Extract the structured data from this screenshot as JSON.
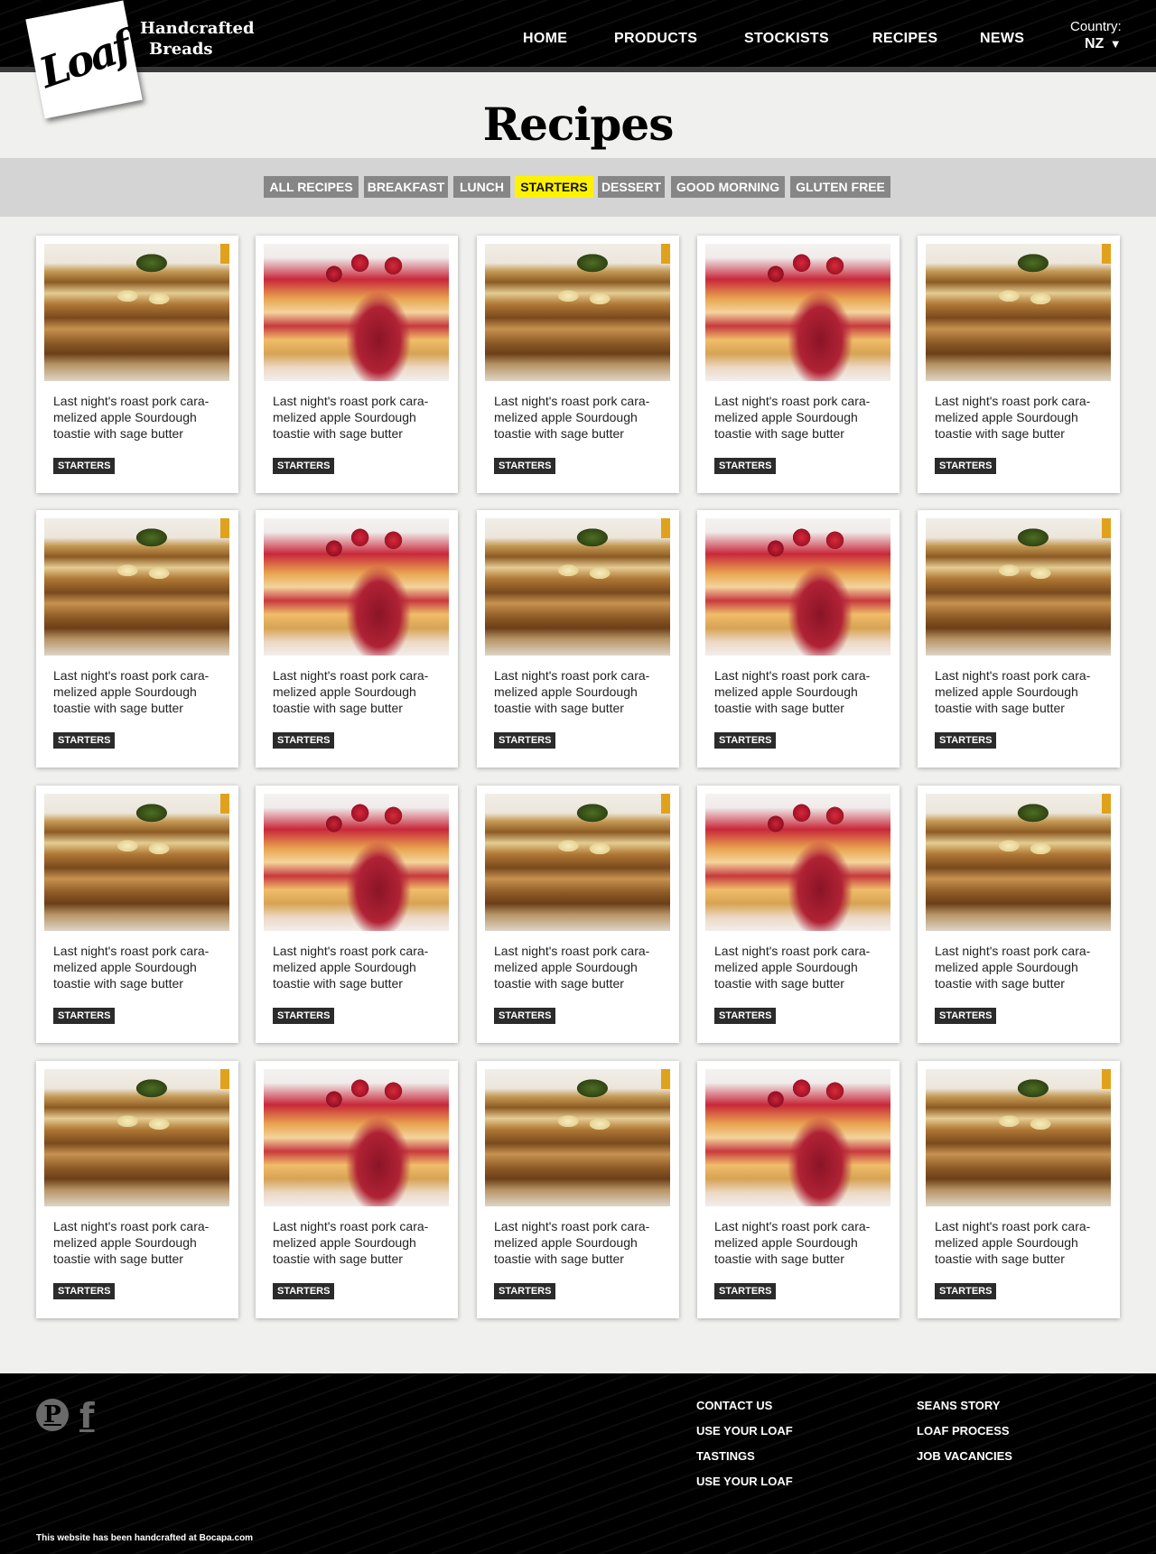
{
  "header": {
    "logo": "Loaf",
    "tagline_line1": "Handcrafted",
    "tagline_line2": "Breads",
    "nav": [
      "HOME",
      "PRODUCTS",
      "STOCKISTS",
      "RECIPES",
      "NEWS"
    ],
    "country_label": "Country:",
    "country_value": "NZ",
    "country_arrow": "▼"
  },
  "page_title": "Recipes",
  "filters": [
    {
      "label": "ALL RECIPES",
      "active": false
    },
    {
      "label": "BREAKFAST",
      "active": false
    },
    {
      "label": "LUNCH",
      "active": false
    },
    {
      "label": "STARTERS",
      "active": true
    },
    {
      "label": "DESSERT",
      "active": false
    },
    {
      "label": "GOOD MORNING",
      "active": false
    },
    {
      "label": "GLUTEN FREE",
      "active": false
    }
  ],
  "recipes": [
    {
      "title": "Last night's roast pork cara-melized apple Sourdough toastie with sage butter",
      "tag": "STARTERS",
      "image": "toastie"
    },
    {
      "title": "Last night's roast pork cara-melized apple Sourdough toastie with sage butter",
      "tag": "STARTERS",
      "image": "dessert"
    },
    {
      "title": "Last night's roast pork cara-melized apple Sourdough toastie with sage butter",
      "tag": "STARTERS",
      "image": "toastie"
    },
    {
      "title": "Last night's roast pork cara-melized apple Sourdough toastie with sage butter",
      "tag": "STARTERS",
      "image": "dessert"
    },
    {
      "title": "Last night's roast pork cara-melized apple Sourdough toastie with sage butter",
      "tag": "STARTERS",
      "image": "toastie"
    },
    {
      "title": "Last night's roast pork cara-melized apple Sourdough toastie with sage butter",
      "tag": "STARTERS",
      "image": "toastie"
    },
    {
      "title": "Last night's roast pork cara-melized apple Sourdough toastie with sage butter",
      "tag": "STARTERS",
      "image": "dessert"
    },
    {
      "title": "Last night's roast pork cara-melized apple Sourdough toastie with sage butter",
      "tag": "STARTERS",
      "image": "toastie"
    },
    {
      "title": "Last night's roast pork cara-melized apple Sourdough toastie with sage butter",
      "tag": "STARTERS",
      "image": "dessert"
    },
    {
      "title": "Last night's roast pork cara-melized apple Sourdough toastie with sage butter",
      "tag": "STARTERS",
      "image": "toastie"
    },
    {
      "title": "Last night's roast pork cara-melized apple Sourdough toastie with sage butter",
      "tag": "STARTERS",
      "image": "toastie"
    },
    {
      "title": "Last night's roast pork cara-melized apple Sourdough toastie with sage butter",
      "tag": "STARTERS",
      "image": "dessert"
    },
    {
      "title": "Last night's roast pork cara-melized apple Sourdough toastie with sage butter",
      "tag": "STARTERS",
      "image": "toastie"
    },
    {
      "title": "Last night's roast pork cara-melized apple Sourdough toastie with sage butter",
      "tag": "STARTERS",
      "image": "dessert"
    },
    {
      "title": "Last night's roast pork cara-melized apple Sourdough toastie with sage butter",
      "tag": "STARTERS",
      "image": "toastie"
    },
    {
      "title": "Last night's roast pork cara-melized apple Sourdough toastie with sage butter",
      "tag": "STARTERS",
      "image": "toastie"
    },
    {
      "title": "Last night's roast pork cara-melized apple Sourdough toastie with sage butter",
      "tag": "STARTERS",
      "image": "dessert"
    },
    {
      "title": "Last night's roast pork cara-melized apple Sourdough toastie with sage butter",
      "tag": "STARTERS",
      "image": "toastie"
    },
    {
      "title": "Last night's roast pork cara-melized apple Sourdough toastie with sage butter",
      "tag": "STARTERS",
      "image": "dessert"
    },
    {
      "title": "Last night's roast pork cara-melized apple Sourdough toastie with sage butter",
      "tag": "STARTERS",
      "image": "toastie"
    }
  ],
  "footer": {
    "social": [
      {
        "name": "pinterest-icon",
        "glyph": "P"
      },
      {
        "name": "facebook-icon",
        "glyph": "f"
      }
    ],
    "links_col1": [
      "CONTACT US",
      "USE YOUR LOAF",
      "TASTINGS",
      "USE YOUR LOAF"
    ],
    "links_col2": [
      "SEANS STORY",
      "LOAF PROCESS",
      "JOB VACANCIES"
    ],
    "credit": "This website has been handcrafted at Bocapa.com"
  },
  "colors": {
    "active_filter": "#fff200",
    "filter_bg": "#868686",
    "header_bg": "#000000",
    "tag_bg": "#2b2b2b"
  }
}
